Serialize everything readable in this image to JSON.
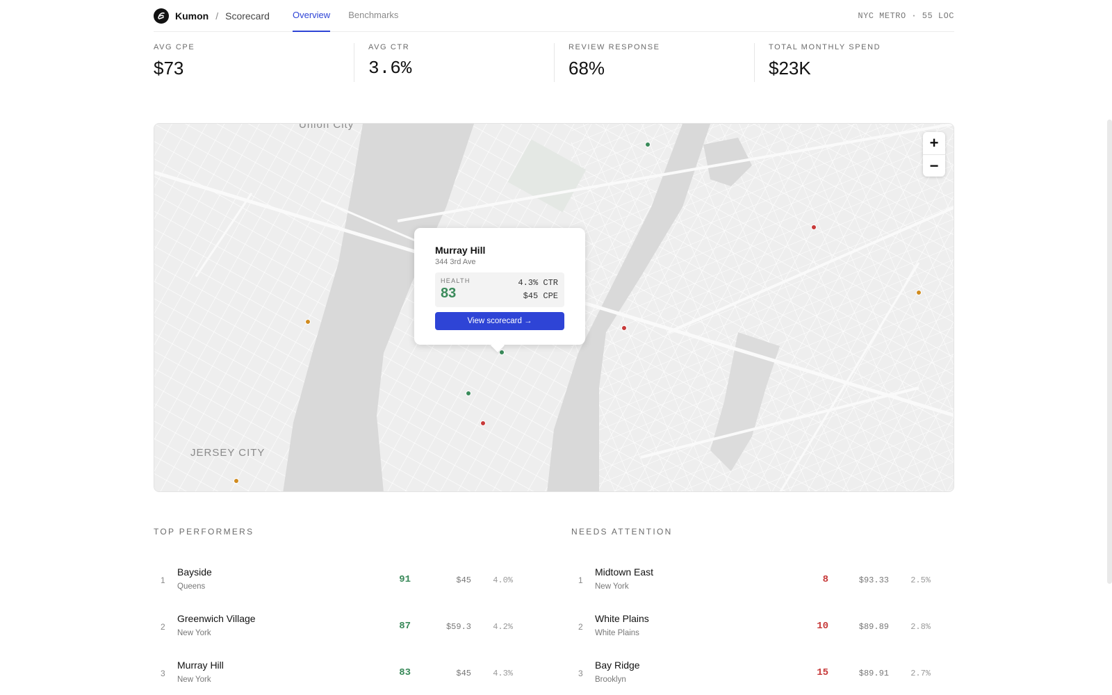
{
  "header": {
    "brand": "Kumon",
    "separator": "/",
    "crumb": "Scorecard",
    "tabs": [
      {
        "label": "Overview",
        "active": true
      },
      {
        "label": "Benchmarks",
        "active": false
      }
    ],
    "region": "NYC METRO · 55 LOC"
  },
  "kpis": [
    {
      "label": "AVG CPE",
      "value": "$73"
    },
    {
      "label": "AVG CTR",
      "value": "3.6%"
    },
    {
      "label": "REVIEW RESPONSE",
      "value": "68%"
    },
    {
      "label": "TOTAL MONTHLY SPEND",
      "value": "$23K"
    }
  ],
  "map": {
    "labels": {
      "union_city": "Union City",
      "jersey_city": "JERSEY CITY"
    },
    "zoom_in": "+",
    "zoom_out": "−",
    "colors": {
      "good": "#3a8a5a",
      "warn": "#d08b1f",
      "bad": "#c73a3a",
      "accent": "#2e44d6"
    },
    "popup": {
      "name": "Murray Hill",
      "address": "344 3rd Ave",
      "health_label": "HEALTH",
      "health": "83",
      "ctr": "4.3% CTR",
      "cpe": "$45 CPE",
      "button": "View scorecard →"
    }
  },
  "top_performers": {
    "title": "TOP PERFORMERS",
    "rows": [
      {
        "rank": "1",
        "name": "Bayside",
        "sub": "Queens",
        "score": "91",
        "cpe": "$45",
        "ctr": "4.0%"
      },
      {
        "rank": "2",
        "name": "Greenwich Village",
        "sub": "New York",
        "score": "87",
        "cpe": "$59.3",
        "ctr": "4.2%"
      },
      {
        "rank": "3",
        "name": "Murray Hill",
        "sub": "New York",
        "score": "83",
        "cpe": "$45",
        "ctr": "4.3%"
      }
    ]
  },
  "needs_attention": {
    "title": "NEEDS ATTENTION",
    "rows": [
      {
        "rank": "1",
        "name": "Midtown East",
        "sub": "New York",
        "score": "8",
        "cpe": "$93.33",
        "ctr": "2.5%"
      },
      {
        "rank": "2",
        "name": "White Plains",
        "sub": "White Plains",
        "score": "10",
        "cpe": "$89.89",
        "ctr": "2.8%"
      },
      {
        "rank": "3",
        "name": "Bay Ridge",
        "sub": "Brooklyn",
        "score": "15",
        "cpe": "$89.91",
        "ctr": "2.7%"
      }
    ]
  }
}
